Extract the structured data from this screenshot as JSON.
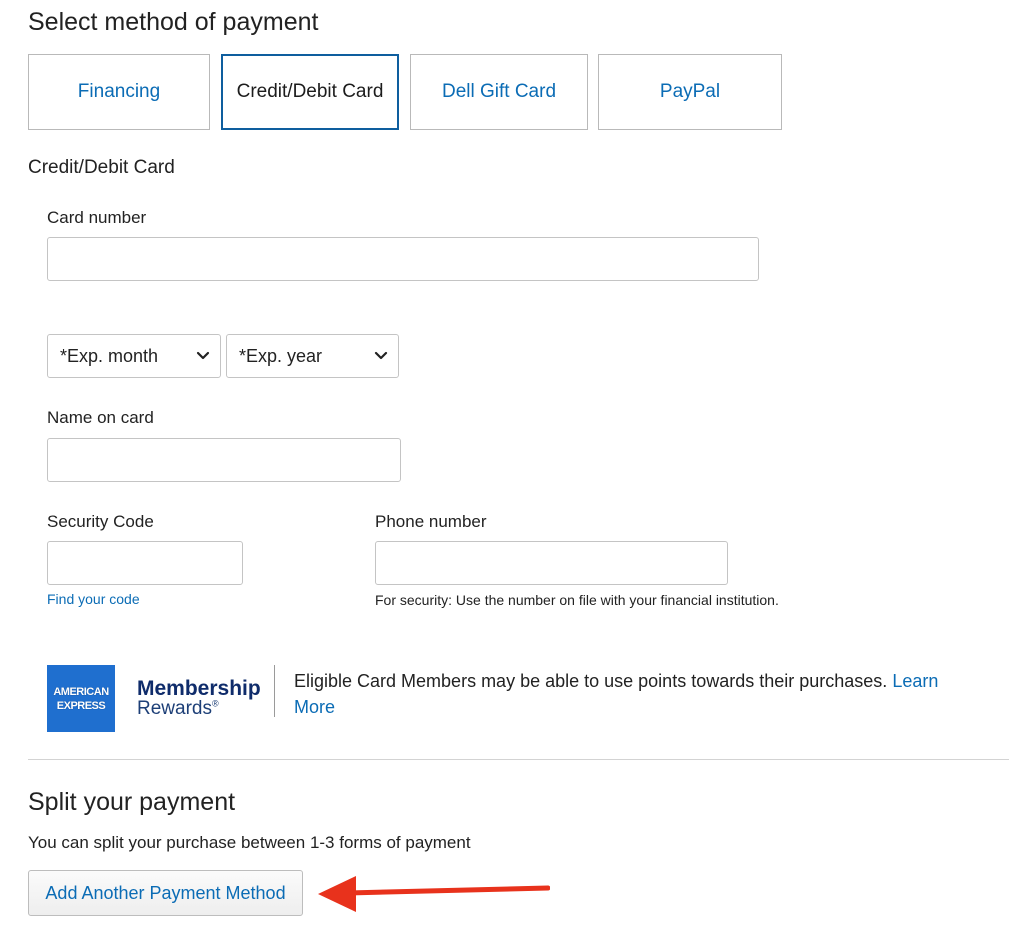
{
  "page": {
    "title": "Select method of payment",
    "tabs": [
      {
        "label": "Financing"
      },
      {
        "label": "Credit/Debit Card"
      },
      {
        "label": "Dell Gift Card"
      },
      {
        "label": "PayPal"
      }
    ],
    "section_title": "Credit/Debit Card"
  },
  "form": {
    "card_number_label": "Card number",
    "card_number_value": "",
    "exp_month": "*Exp. month",
    "exp_year": "*Exp. year",
    "name_label": "Name on card",
    "name_value": "",
    "security_label": "Security Code",
    "security_value": "",
    "find_code_link": "Find your code",
    "phone_label": "Phone number",
    "phone_value": "",
    "phone_hint": "For security: Use the number on file with your financial institution."
  },
  "amex": {
    "logo_line1": "AMERICAN",
    "logo_line2": "EXPRESS",
    "brand_title": "Membership",
    "brand_sub": "Rewards",
    "reg": "®",
    "text": "Eligible Card Members may be able to use points towards their purchases.",
    "learn": "Learn",
    "more": "More"
  },
  "split": {
    "title": "Split your payment",
    "text": "You can split your purchase between 1-3 forms of payment",
    "button": "Add Another Payment Method"
  },
  "colors": {
    "link": "#0b6cb5",
    "selected_border": "#0e5e9e",
    "amex_blue": "#1f6fcf",
    "arrow": "#e8321c"
  },
  "icons": {
    "select_chevron": "chevron-down-icon",
    "annotation_arrow": "arrow-left-icon"
  }
}
